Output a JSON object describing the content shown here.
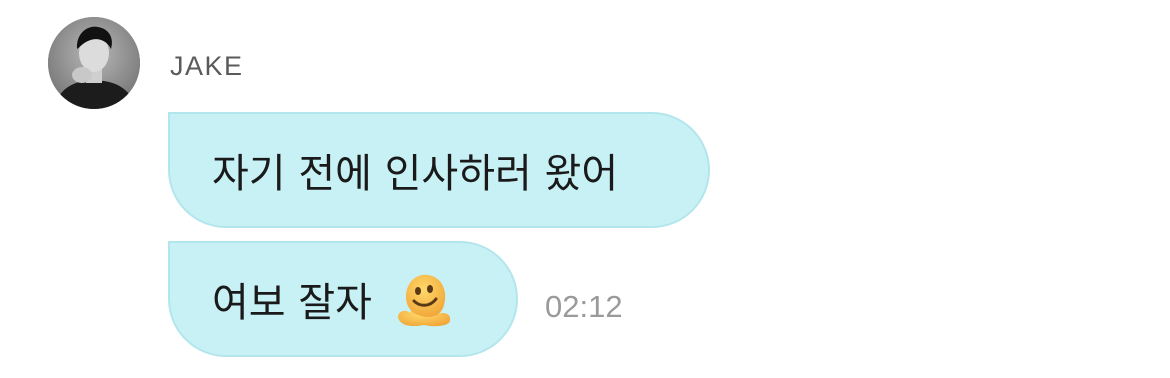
{
  "chat": {
    "sender_name": "JAKE",
    "avatar_icon": "profile-photo",
    "messages": [
      {
        "text": "자기 전에 인사하러 왔어"
      },
      {
        "text": "여보 잘자",
        "emoji": "melting-face-emoji"
      }
    ],
    "timestamp": "02:12"
  },
  "colors": {
    "bubble_bg": "#c8f1f5",
    "bubble_border": "#b3e6ec",
    "sender_text": "#5a5a5a",
    "timestamp_text": "#9a9a9a"
  }
}
